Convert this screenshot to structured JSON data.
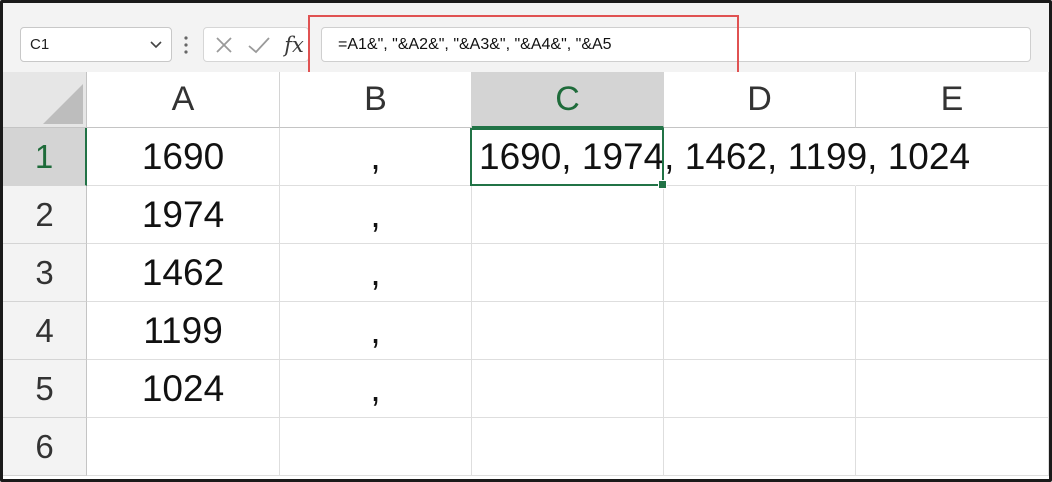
{
  "formula_bar": {
    "name_box": "C1",
    "formula": "=A1&\", \"&A2&\", \"&A3&\", \"&A4&\", \"&A5",
    "fx_label": "fx",
    "icons": {
      "name_box_dropdown": "chevron-down-icon",
      "more": "vertical-dots-icon",
      "cancel": "close-icon",
      "enter": "checkmark-icon",
      "insert_function": "function-icon"
    },
    "highlight_color": "#e05252"
  },
  "grid": {
    "columns": [
      "A",
      "B",
      "C",
      "D",
      "E"
    ],
    "active_column": "C",
    "rows": [
      "1",
      "2",
      "3",
      "4",
      "5",
      "6"
    ],
    "active_row": "1",
    "active_cell": "C1",
    "cells": {
      "A": [
        "1690",
        "1974",
        "1462",
        "1199",
        "1024",
        ""
      ],
      "B": [
        ",",
        ",",
        ",",
        ",",
        ",",
        ""
      ]
    },
    "c1_value": "1690, 1974, 1462, 1199, 1024",
    "accent_color": "#217346"
  }
}
